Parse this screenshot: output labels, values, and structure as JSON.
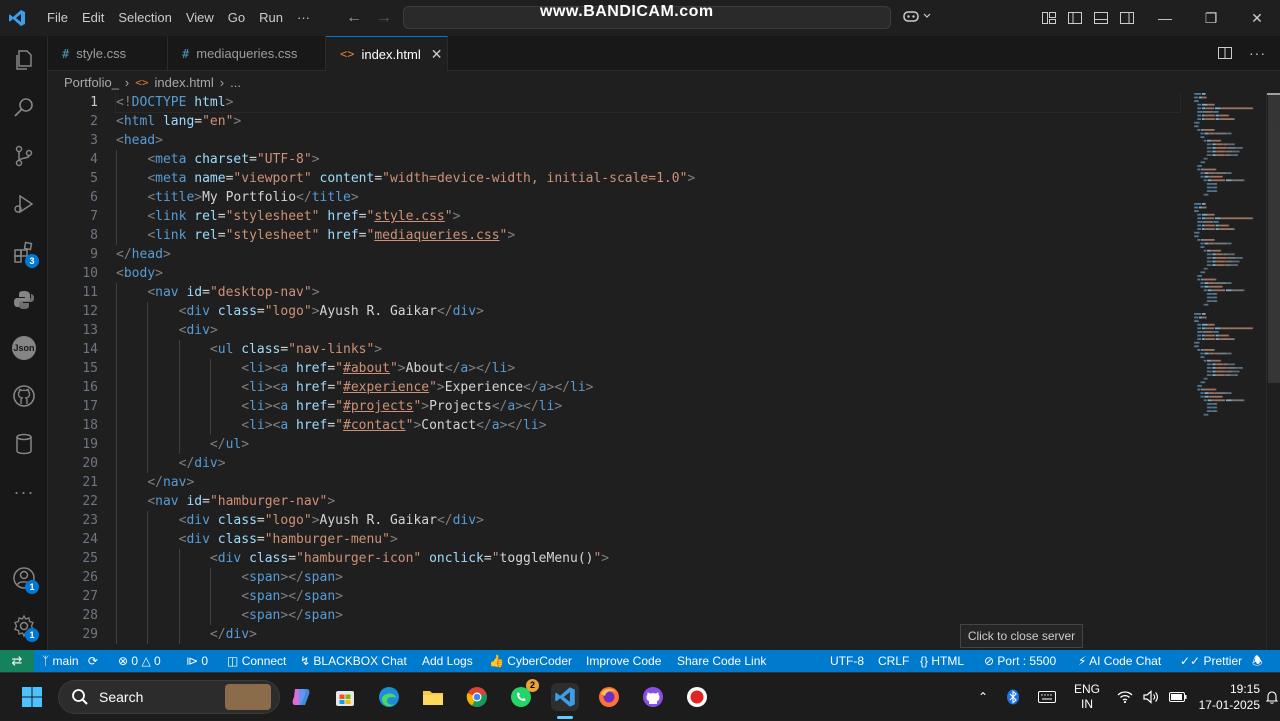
{
  "menu": [
    "File",
    "Edit",
    "Selection",
    "View",
    "Go",
    "Run",
    "···"
  ],
  "watermark": "www.BANDICAM.com",
  "tabs": [
    {
      "label": "style.css",
      "icon": "#"
    },
    {
      "label": "mediaqueries.css",
      "icon": "#"
    },
    {
      "label": "index.html",
      "icon": "<>"
    }
  ],
  "breadcrumb": {
    "folder": "Portfolio_",
    "file": "index.html",
    "more": "..."
  },
  "activity_badges": {
    "extensions": "3",
    "accounts": "1",
    "manage": "1"
  },
  "tooltip": "Click to close server",
  "statusbar": {
    "branch": "main",
    "errors": "0",
    "warnings": "0",
    "ports": "0",
    "connect": "Connect",
    "blackbox": "BLACKBOX Chat",
    "addlogs": "Add Logs",
    "cybercoder": "CyberCoder",
    "improve": "Improve Code",
    "share": "Share Code Link",
    "encoding": "UTF-8",
    "eol": "CRLF",
    "language": "HTML",
    "port": "Port : 5500",
    "aichat": "AI Code Chat",
    "prettier": "Prettier"
  },
  "taskbar": {
    "search": "Search",
    "lang": "ENG",
    "region": "IN",
    "time": "19:15",
    "date": "17-01-2025",
    "whatsapp_badge": "2"
  },
  "colors": {
    "accent": "#007acc",
    "editor_bg": "#1f1f1f",
    "tag": "#569cd6",
    "attr": "#9cdcfe",
    "string": "#ce9178"
  },
  "code_lines": [
    [
      {
        "c": "t",
        "v": "<!"
      },
      {
        "c": "tn",
        "v": "DOCTYPE"
      },
      {
        "c": "tx",
        "v": " "
      },
      {
        "c": "an",
        "v": "html"
      },
      {
        "c": "t",
        "v": ">"
      }
    ],
    [
      {
        "c": "t",
        "v": "<"
      },
      {
        "c": "tn",
        "v": "html"
      },
      {
        "c": "tx",
        "v": " "
      },
      {
        "c": "an",
        "v": "lang"
      },
      {
        "c": "tx",
        "v": "="
      },
      {
        "c": "av",
        "v": "\"en\""
      },
      {
        "c": "t",
        "v": ">"
      }
    ],
    [
      {
        "c": "t",
        "v": "<"
      },
      {
        "c": "tn",
        "v": "head"
      },
      {
        "c": "t",
        "v": ">"
      }
    ],
    [
      {
        "c": "tx",
        "v": "    "
      },
      {
        "c": "t",
        "v": "<"
      },
      {
        "c": "tn",
        "v": "meta"
      },
      {
        "c": "tx",
        "v": " "
      },
      {
        "c": "an",
        "v": "charset"
      },
      {
        "c": "tx",
        "v": "="
      },
      {
        "c": "av",
        "v": "\"UTF-8\""
      },
      {
        "c": "t",
        "v": ">"
      }
    ],
    [
      {
        "c": "tx",
        "v": "    "
      },
      {
        "c": "t",
        "v": "<"
      },
      {
        "c": "tn",
        "v": "meta"
      },
      {
        "c": "tx",
        "v": " "
      },
      {
        "c": "an",
        "v": "name"
      },
      {
        "c": "tx",
        "v": "="
      },
      {
        "c": "av",
        "v": "\"viewport\""
      },
      {
        "c": "tx",
        "v": " "
      },
      {
        "c": "an",
        "v": "content"
      },
      {
        "c": "tx",
        "v": "="
      },
      {
        "c": "av",
        "v": "\"width=device-width, initial-scale=1.0\""
      },
      {
        "c": "t",
        "v": ">"
      }
    ],
    [
      {
        "c": "tx",
        "v": "    "
      },
      {
        "c": "t",
        "v": "<"
      },
      {
        "c": "tn",
        "v": "title"
      },
      {
        "c": "t",
        "v": ">"
      },
      {
        "c": "tx",
        "v": "My Portfolio"
      },
      {
        "c": "t",
        "v": "</"
      },
      {
        "c": "tn",
        "v": "title"
      },
      {
        "c": "t",
        "v": ">"
      }
    ],
    [
      {
        "c": "tx",
        "v": "    "
      },
      {
        "c": "t",
        "v": "<"
      },
      {
        "c": "tn",
        "v": "link"
      },
      {
        "c": "tx",
        "v": " "
      },
      {
        "c": "an",
        "v": "rel"
      },
      {
        "c": "tx",
        "v": "="
      },
      {
        "c": "av",
        "v": "\"stylesheet\""
      },
      {
        "c": "tx",
        "v": " "
      },
      {
        "c": "an",
        "v": "href"
      },
      {
        "c": "tx",
        "v": "="
      },
      {
        "c": "av",
        "v": "\""
      },
      {
        "c": "av u",
        "v": "style.css"
      },
      {
        "c": "av",
        "v": "\""
      },
      {
        "c": "t",
        "v": ">"
      }
    ],
    [
      {
        "c": "tx",
        "v": "    "
      },
      {
        "c": "t",
        "v": "<"
      },
      {
        "c": "tn",
        "v": "link"
      },
      {
        "c": "tx",
        "v": " "
      },
      {
        "c": "an",
        "v": "rel"
      },
      {
        "c": "tx",
        "v": "="
      },
      {
        "c": "av",
        "v": "\"stylesheet\""
      },
      {
        "c": "tx",
        "v": " "
      },
      {
        "c": "an",
        "v": "href"
      },
      {
        "c": "tx",
        "v": "="
      },
      {
        "c": "av",
        "v": "\""
      },
      {
        "c": "av u",
        "v": "mediaqueries.css"
      },
      {
        "c": "av",
        "v": "\""
      },
      {
        "c": "t",
        "v": ">"
      }
    ],
    [
      {
        "c": "t",
        "v": "</"
      },
      {
        "c": "tn",
        "v": "head"
      },
      {
        "c": "t",
        "v": ">"
      }
    ],
    [
      {
        "c": "t",
        "v": "<"
      },
      {
        "c": "tn",
        "v": "body"
      },
      {
        "c": "t",
        "v": ">"
      }
    ],
    [
      {
        "c": "tx",
        "v": "    "
      },
      {
        "c": "t",
        "v": "<"
      },
      {
        "c": "tn",
        "v": "nav"
      },
      {
        "c": "tx",
        "v": " "
      },
      {
        "c": "an",
        "v": "id"
      },
      {
        "c": "tx",
        "v": "="
      },
      {
        "c": "av",
        "v": "\"desktop-nav\""
      },
      {
        "c": "t",
        "v": ">"
      }
    ],
    [
      {
        "c": "tx",
        "v": "        "
      },
      {
        "c": "t",
        "v": "<"
      },
      {
        "c": "tn",
        "v": "div"
      },
      {
        "c": "tx",
        "v": " "
      },
      {
        "c": "an",
        "v": "class"
      },
      {
        "c": "tx",
        "v": "="
      },
      {
        "c": "av",
        "v": "\"logo\""
      },
      {
        "c": "t",
        "v": ">"
      },
      {
        "c": "tx",
        "v": "Ayush R. Gaikar"
      },
      {
        "c": "t",
        "v": "</"
      },
      {
        "c": "tn",
        "v": "div"
      },
      {
        "c": "t",
        "v": ">"
      }
    ],
    [
      {
        "c": "tx",
        "v": "        "
      },
      {
        "c": "t",
        "v": "<"
      },
      {
        "c": "tn",
        "v": "div"
      },
      {
        "c": "t",
        "v": ">"
      }
    ],
    [
      {
        "c": "tx",
        "v": "            "
      },
      {
        "c": "t",
        "v": "<"
      },
      {
        "c": "tn",
        "v": "ul"
      },
      {
        "c": "tx",
        "v": " "
      },
      {
        "c": "an",
        "v": "class"
      },
      {
        "c": "tx",
        "v": "="
      },
      {
        "c": "av",
        "v": "\"nav-links\""
      },
      {
        "c": "t",
        "v": ">"
      }
    ],
    [
      {
        "c": "tx",
        "v": "                "
      },
      {
        "c": "t",
        "v": "<"
      },
      {
        "c": "tn",
        "v": "li"
      },
      {
        "c": "t",
        "v": "><"
      },
      {
        "c": "tn",
        "v": "a"
      },
      {
        "c": "tx",
        "v": " "
      },
      {
        "c": "an",
        "v": "href"
      },
      {
        "c": "tx",
        "v": "="
      },
      {
        "c": "av",
        "v": "\""
      },
      {
        "c": "av u",
        "v": "#about"
      },
      {
        "c": "av",
        "v": "\""
      },
      {
        "c": "t",
        "v": ">"
      },
      {
        "c": "tx",
        "v": "About"
      },
      {
        "c": "t",
        "v": "</"
      },
      {
        "c": "tn",
        "v": "a"
      },
      {
        "c": "t",
        "v": "></"
      },
      {
        "c": "tn",
        "v": "li"
      },
      {
        "c": "t",
        "v": ">"
      }
    ],
    [
      {
        "c": "tx",
        "v": "                "
      },
      {
        "c": "t",
        "v": "<"
      },
      {
        "c": "tn",
        "v": "li"
      },
      {
        "c": "t",
        "v": "><"
      },
      {
        "c": "tn",
        "v": "a"
      },
      {
        "c": "tx",
        "v": " "
      },
      {
        "c": "an",
        "v": "href"
      },
      {
        "c": "tx",
        "v": "="
      },
      {
        "c": "av",
        "v": "\""
      },
      {
        "c": "av u",
        "v": "#experience"
      },
      {
        "c": "av",
        "v": "\""
      },
      {
        "c": "t",
        "v": ">"
      },
      {
        "c": "tx",
        "v": "Experience"
      },
      {
        "c": "t",
        "v": "</"
      },
      {
        "c": "tn",
        "v": "a"
      },
      {
        "c": "t",
        "v": "></"
      },
      {
        "c": "tn",
        "v": "li"
      },
      {
        "c": "t",
        "v": ">"
      }
    ],
    [
      {
        "c": "tx",
        "v": "                "
      },
      {
        "c": "t",
        "v": "<"
      },
      {
        "c": "tn",
        "v": "li"
      },
      {
        "c": "t",
        "v": "><"
      },
      {
        "c": "tn",
        "v": "a"
      },
      {
        "c": "tx",
        "v": " "
      },
      {
        "c": "an",
        "v": "href"
      },
      {
        "c": "tx",
        "v": "="
      },
      {
        "c": "av",
        "v": "\""
      },
      {
        "c": "av u",
        "v": "#projects"
      },
      {
        "c": "av",
        "v": "\""
      },
      {
        "c": "t",
        "v": ">"
      },
      {
        "c": "tx",
        "v": "Projects"
      },
      {
        "c": "t",
        "v": "</"
      },
      {
        "c": "tn",
        "v": "a"
      },
      {
        "c": "t",
        "v": "></"
      },
      {
        "c": "tn",
        "v": "li"
      },
      {
        "c": "t",
        "v": ">"
      }
    ],
    [
      {
        "c": "tx",
        "v": "                "
      },
      {
        "c": "t",
        "v": "<"
      },
      {
        "c": "tn",
        "v": "li"
      },
      {
        "c": "t",
        "v": "><"
      },
      {
        "c": "tn",
        "v": "a"
      },
      {
        "c": "tx",
        "v": " "
      },
      {
        "c": "an",
        "v": "href"
      },
      {
        "c": "tx",
        "v": "="
      },
      {
        "c": "av",
        "v": "\""
      },
      {
        "c": "av u",
        "v": "#contact"
      },
      {
        "c": "av",
        "v": "\""
      },
      {
        "c": "t",
        "v": ">"
      },
      {
        "c": "tx",
        "v": "Contact"
      },
      {
        "c": "t",
        "v": "</"
      },
      {
        "c": "tn",
        "v": "a"
      },
      {
        "c": "t",
        "v": "></"
      },
      {
        "c": "tn",
        "v": "li"
      },
      {
        "c": "t",
        "v": ">"
      }
    ],
    [
      {
        "c": "tx",
        "v": "            "
      },
      {
        "c": "t",
        "v": "</"
      },
      {
        "c": "tn",
        "v": "ul"
      },
      {
        "c": "t",
        "v": ">"
      }
    ],
    [
      {
        "c": "tx",
        "v": "        "
      },
      {
        "c": "t",
        "v": "</"
      },
      {
        "c": "tn",
        "v": "div"
      },
      {
        "c": "t",
        "v": ">"
      }
    ],
    [
      {
        "c": "tx",
        "v": "    "
      },
      {
        "c": "t",
        "v": "</"
      },
      {
        "c": "tn",
        "v": "nav"
      },
      {
        "c": "t",
        "v": ">"
      }
    ],
    [
      {
        "c": "tx",
        "v": "    "
      },
      {
        "c": "t",
        "v": "<"
      },
      {
        "c": "tn",
        "v": "nav"
      },
      {
        "c": "tx",
        "v": " "
      },
      {
        "c": "an",
        "v": "id"
      },
      {
        "c": "tx",
        "v": "="
      },
      {
        "c": "av",
        "v": "\"hamburger-nav\""
      },
      {
        "c": "t",
        "v": ">"
      }
    ],
    [
      {
        "c": "tx",
        "v": "        "
      },
      {
        "c": "t",
        "v": "<"
      },
      {
        "c": "tn",
        "v": "div"
      },
      {
        "c": "tx",
        "v": " "
      },
      {
        "c": "an",
        "v": "class"
      },
      {
        "c": "tx",
        "v": "="
      },
      {
        "c": "av",
        "v": "\"logo\""
      },
      {
        "c": "t",
        "v": ">"
      },
      {
        "c": "tx",
        "v": "Ayush R. Gaikar"
      },
      {
        "c": "t",
        "v": "</"
      },
      {
        "c": "tn",
        "v": "div"
      },
      {
        "c": "t",
        "v": ">"
      }
    ],
    [
      {
        "c": "tx",
        "v": "        "
      },
      {
        "c": "t",
        "v": "<"
      },
      {
        "c": "tn",
        "v": "div"
      },
      {
        "c": "tx",
        "v": " "
      },
      {
        "c": "an",
        "v": "class"
      },
      {
        "c": "tx",
        "v": "="
      },
      {
        "c": "av",
        "v": "\"hamburger-menu\""
      },
      {
        "c": "t",
        "v": ">"
      }
    ],
    [
      {
        "c": "tx",
        "v": "            "
      },
      {
        "c": "t",
        "v": "<"
      },
      {
        "c": "tn",
        "v": "div"
      },
      {
        "c": "tx",
        "v": " "
      },
      {
        "c": "an",
        "v": "class"
      },
      {
        "c": "tx",
        "v": "="
      },
      {
        "c": "av",
        "v": "\"hamburger-icon\""
      },
      {
        "c": "tx",
        "v": " "
      },
      {
        "c": "an",
        "v": "onclick"
      },
      {
        "c": "tx",
        "v": "="
      },
      {
        "c": "av",
        "v": "\""
      },
      {
        "c": "tx",
        "v": "toggleMenu()"
      },
      {
        "c": "av",
        "v": "\""
      },
      {
        "c": "t",
        "v": ">"
      }
    ],
    [
      {
        "c": "tx",
        "v": "                "
      },
      {
        "c": "t",
        "v": "<"
      },
      {
        "c": "tn",
        "v": "span"
      },
      {
        "c": "t",
        "v": "></"
      },
      {
        "c": "tn",
        "v": "span"
      },
      {
        "c": "t",
        "v": ">"
      }
    ],
    [
      {
        "c": "tx",
        "v": "                "
      },
      {
        "c": "t",
        "v": "<"
      },
      {
        "c": "tn",
        "v": "span"
      },
      {
        "c": "t",
        "v": "></"
      },
      {
        "c": "tn",
        "v": "span"
      },
      {
        "c": "t",
        "v": ">"
      }
    ],
    [
      {
        "c": "tx",
        "v": "                "
      },
      {
        "c": "t",
        "v": "<"
      },
      {
        "c": "tn",
        "v": "span"
      },
      {
        "c": "t",
        "v": "></"
      },
      {
        "c": "tn",
        "v": "span"
      },
      {
        "c": "t",
        "v": ">"
      }
    ],
    [
      {
        "c": "tx",
        "v": "            "
      },
      {
        "c": "t",
        "v": "</"
      },
      {
        "c": "tn",
        "v": "div"
      },
      {
        "c": "t",
        "v": ">"
      }
    ]
  ]
}
